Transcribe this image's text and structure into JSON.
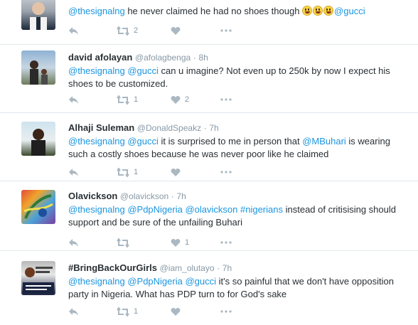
{
  "tweets": [
    {
      "name": "",
      "handle": "",
      "time": "",
      "parts": [
        {
          "t": "@thesignalng",
          "link": true
        },
        {
          "t": " he never claimed he had no shoes though ",
          "link": false
        },
        {
          "emoji": "grinning-face-emoji"
        },
        {
          "emoji": "grinning-face-emoji"
        },
        {
          "emoji": "grinning-face-emoji"
        },
        {
          "t": "@gucci",
          "link": true
        }
      ],
      "retweets": "2",
      "likes": ""
    },
    {
      "name": "david afolayan",
      "handle": "@afolagbenga",
      "time": "8h",
      "parts": [
        {
          "t": "@thesignalng",
          "link": true
        },
        {
          "t": " ",
          "link": false
        },
        {
          "t": "@gucci",
          "link": true
        },
        {
          "t": " can u imagine? Not even up to 250k by now I expect his shoes to be customized.",
          "link": false
        }
      ],
      "retweets": "1",
      "likes": "2"
    },
    {
      "name": "Alhaji Suleman",
      "handle": "@DonaldSpeakz",
      "time": "7h",
      "parts": [
        {
          "t": "@thesignalng",
          "link": true
        },
        {
          "t": " ",
          "link": false
        },
        {
          "t": "@gucci",
          "link": true
        },
        {
          "t": " it is surprised to me in person that ",
          "link": false
        },
        {
          "t": "@MBuhari",
          "link": true
        },
        {
          "t": " is wearing such a costly shoes because he was never poor like he claimed",
          "link": false
        }
      ],
      "retweets": "1",
      "likes": ""
    },
    {
      "name": "Olavickson",
      "handle": "@olavickson",
      "time": "7h",
      "parts": [
        {
          "t": "@thesignalng",
          "link": true
        },
        {
          "t": " ",
          "link": false
        },
        {
          "t": "@PdpNigeria",
          "link": true
        },
        {
          "t": " ",
          "link": false
        },
        {
          "t": "@olavickson",
          "link": true
        },
        {
          "t": " ",
          "link": false
        },
        {
          "t": "#nigerians",
          "link": true
        },
        {
          "t": " instead of critisising should support and be sure of the unfailing Buhari",
          "link": false
        }
      ],
      "retweets": "",
      "likes": "1"
    },
    {
      "name": "#BringBackOurGirls",
      "handle": "@iam_olutayo",
      "time": "7h",
      "parts": [
        {
          "t": "@thesignalng",
          "link": true
        },
        {
          "t": " ",
          "link": false
        },
        {
          "t": "@PdpNigeria",
          "link": true
        },
        {
          "t": " ",
          "link": false
        },
        {
          "t": "@gucci",
          "link": true
        },
        {
          "t": " it's so painful that we don't have opposition party in Nigeria. What has PDP turn to for God's sake",
          "link": false
        }
      ],
      "retweets": "1",
      "likes": ""
    }
  ],
  "colors": {
    "link": "#1b95e0",
    "icon": "#aab8c2",
    "meta": "#8899a6",
    "divider": "#e1e8ed"
  },
  "icons": {
    "reply": "reply-icon",
    "retweet": "retweet-icon",
    "like": "heart-icon",
    "more": "more-icon"
  }
}
